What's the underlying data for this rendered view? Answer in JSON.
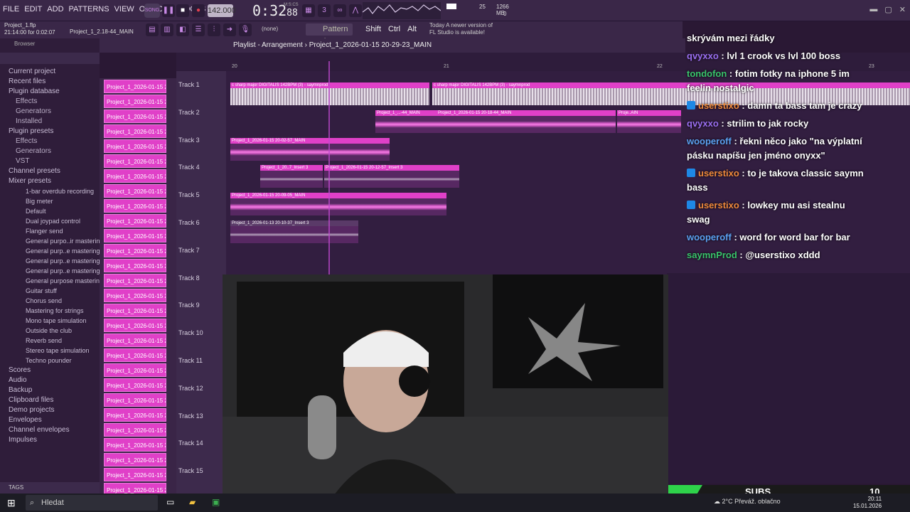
{
  "menu": [
    "FILE",
    "EDIT",
    "ADD",
    "PATTERNS",
    "VIEW",
    "OPTIONS",
    "TOOLS",
    "HELP"
  ],
  "transport": {
    "song_mode": "SONG",
    "tempo": "142.000",
    "time_main": "0:32",
    "time_sub": "88",
    "time_unit": "M:S:CS",
    "cpu": "25",
    "memory": "1266 MB",
    "polyphony": "0"
  },
  "project": {
    "file": "Project_1.flp",
    "position": "21:14:00 for 0:02:07",
    "pattern_name": "Project_1_2.18-44_MAIN"
  },
  "toolbar2": {
    "none_select": "(none)",
    "pattern": "Pattern 1",
    "keys": [
      "Shift",
      "Ctrl",
      "Alt"
    ],
    "news_line1": "Today  A newer version of",
    "news_line2": "FL Studio is available!"
  },
  "browser": {
    "title": "Browser",
    "items": [
      {
        "label": "Current project",
        "level": 0
      },
      {
        "label": "Recent files",
        "level": 0
      },
      {
        "label": "Plugin database",
        "level": 0
      },
      {
        "label": "Effects",
        "level": 1
      },
      {
        "label": "Generators",
        "level": 1
      },
      {
        "label": "Installed",
        "level": 1
      },
      {
        "label": "Plugin presets",
        "level": 0
      },
      {
        "label": "Effects",
        "level": 1
      },
      {
        "label": "Generators",
        "level": 1
      },
      {
        "label": "VST",
        "level": 1
      },
      {
        "label": "Channel presets",
        "level": 0
      },
      {
        "label": "Mixer presets",
        "level": 0
      },
      {
        "label": "1-bar overdub recording",
        "level": 2
      },
      {
        "label": "Big meter",
        "level": 2
      },
      {
        "label": "Default",
        "level": 2
      },
      {
        "label": "Dual joypad control",
        "level": 2
      },
      {
        "label": "Flanger send",
        "level": 2
      },
      {
        "label": "General purpo..ir mastering",
        "level": 2
      },
      {
        "label": "General purp..e mastering 2",
        "level": 2
      },
      {
        "label": "General purp..e mastering 3",
        "level": 2
      },
      {
        "label": "General purp..e mastering 4",
        "level": 2
      },
      {
        "label": "General purpose mastering",
        "level": 2
      },
      {
        "label": "Guitar stuff",
        "level": 2
      },
      {
        "label": "Chorus send",
        "level": 2
      },
      {
        "label": "Mastering for strings",
        "level": 2
      },
      {
        "label": "Mono tape simulation",
        "level": 2
      },
      {
        "label": "Outside the club",
        "level": 2
      },
      {
        "label": "Reverb send",
        "level": 2
      },
      {
        "label": "Stereo tape simulation",
        "level": 2
      },
      {
        "label": "Techno pounder",
        "level": 2
      },
      {
        "label": "Scores",
        "level": 0
      },
      {
        "label": "Audio",
        "level": 0
      },
      {
        "label": "Backup",
        "level": 0
      },
      {
        "label": "Clipboard files",
        "level": 0
      },
      {
        "label": "Demo projects",
        "level": 0
      },
      {
        "label": "Envelopes",
        "level": 0
      },
      {
        "label": "Channel envelopes",
        "level": 0
      },
      {
        "label": "Impulses",
        "level": 0
      }
    ],
    "tags_label": "TAGS"
  },
  "pattern_list": {
    "item_label": "Project_1_2026-01-15 2...",
    "count": 28
  },
  "playlist": {
    "title": "Playlist - Arrangement",
    "breadcrumb": "Project_1_2026-01-15 20-29-23_MAIN",
    "ruler": [
      "20",
      "21",
      "22",
      "23"
    ],
    "tracks": [
      "Track 1",
      "Track 2",
      "Track 3",
      "Track 4",
      "Track 5",
      "Track 6",
      "Track 7",
      "Track 8",
      "Track 9",
      "Track 10",
      "Track 11",
      "Track 12",
      "Track 13",
      "Track 14",
      "Track 15"
    ],
    "clips": [
      {
        "track": 0,
        "label": "c sharp major DIGITALIS 142BPM (3) - saymnprod"
      },
      {
        "track": 0,
        "label": "c sharp major DIGITALIS 142BPM (3) - saymnprod"
      },
      {
        "track": 1,
        "label": "Project_1_...-44_MAIN"
      },
      {
        "track": 1,
        "label": "Project_1_2026-01-15 20-18-44_MAIN"
      },
      {
        "track": 1,
        "label": "Proje..AIN"
      },
      {
        "track": 2,
        "label": "Project_1_2026-01-15 20-02-57_MAIN"
      },
      {
        "track": 3,
        "label": "Project_1_20..7_Insert 3"
      },
      {
        "track": 3,
        "label": "Project_1_2026-01-15 20-12-57_Insert 3"
      },
      {
        "track": 4,
        "label": "Project_1_2026-01-15 20-09-05_MAIN"
      },
      {
        "track": 5,
        "label": "Project_1_2026-01-13 20-10-37_Insert 3"
      }
    ]
  },
  "chat": [
    {
      "user": "",
      "text": "skrývám mezi řádky",
      "color": "",
      "badge": false
    },
    {
      "user": "qvyxxo",
      "text": "lvl 1 crook vs lvl 100 boss",
      "color": "purple",
      "badge": false
    },
    {
      "user": "tondofon",
      "text": "fotim fotky na iphone 5 im feelin nostalgic",
      "color": "green",
      "badge": false
    },
    {
      "user": "userstixo",
      "text": "damn ta bass tam je crazy",
      "color": "orange",
      "badge": true
    },
    {
      "user": "qvyxxo",
      "text": "strilim to jak rocky",
      "color": "purple",
      "badge": false
    },
    {
      "user": "wooperoff",
      "text": "řekni něco jako \"na výplatní pásku napíšu jen jméno onyxx\"",
      "color": "blue",
      "badge": false
    },
    {
      "user": "userstixo",
      "text": "to je takova classic saymn bass",
      "color": "orange",
      "badge": true
    },
    {
      "user": "userstixo",
      "text": "lowkey mu asi stealnu swag",
      "color": "orange",
      "badge": true
    },
    {
      "user": "wooperoff",
      "text": "word for word bar for bar",
      "color": "blue",
      "badge": false
    },
    {
      "user": "saymnProd",
      "text": "@userstixo xddd",
      "color": "green",
      "badge": false
    }
  ],
  "overlay": {
    "subs_label": "SUBS",
    "subs_count": "10"
  },
  "taskbar": {
    "search_placeholder": "Hledat",
    "weather": "2°C  Převáž. oblačno",
    "time": "20:11",
    "date": "15.01.2026"
  },
  "colors": {
    "accent": "#e040c8",
    "background": "#2a1834",
    "subs_green": "#2ed24a"
  }
}
